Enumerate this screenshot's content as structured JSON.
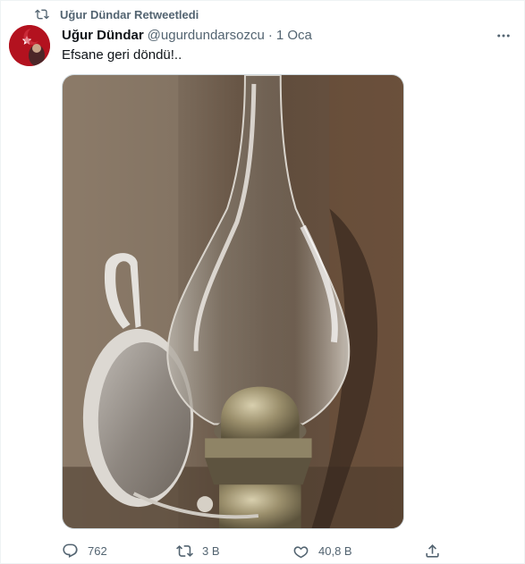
{
  "retweet_context": {
    "text": "Uğur Dündar Retweetledi",
    "icon": "retweet-icon"
  },
  "author": {
    "display_name": "Uğur Dündar",
    "handle": "@ugurdundarsozcu",
    "separator": "·",
    "timestamp": "1 Oca"
  },
  "tweet": {
    "text": "Efsane geri döndü!.."
  },
  "media": {
    "description_icon": "kerosene-lamp-photo"
  },
  "actions": {
    "replies": "762",
    "retweets": "3 B",
    "likes": "40,8 B"
  },
  "colors": {
    "text": "#0f1419",
    "secondary": "#536471",
    "border": "#cfd9de"
  }
}
